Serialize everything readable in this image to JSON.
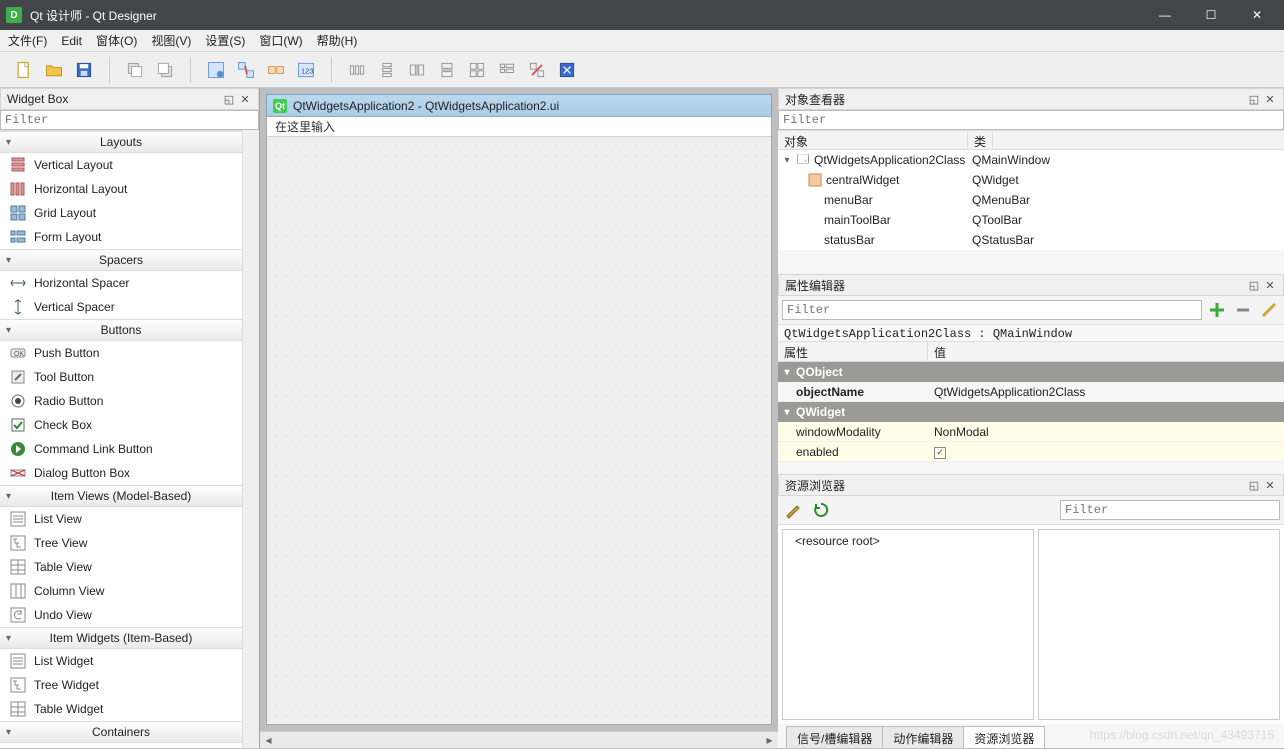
{
  "titlebar": {
    "title": "Qt 设计师 - Qt Designer"
  },
  "menu": {
    "file": "文件(F)",
    "edit": "Edit",
    "form": "窗体(O)",
    "view": "视图(V)",
    "settings": "设置(S)",
    "window": "窗口(W)",
    "help": "帮助(H)"
  },
  "left": {
    "title": "Widget Box",
    "filter_placeholder": "Filter",
    "categories": {
      "layouts": "Layouts",
      "spacers": "Spacers",
      "buttons": "Buttons",
      "item_views": "Item Views (Model-Based)",
      "item_widgets": "Item Widgets (Item-Based)",
      "containers": "Containers"
    },
    "items": {
      "vlayout": "Vertical Layout",
      "hlayout": "Horizontal Layout",
      "gridlayout": "Grid Layout",
      "formlayout": "Form Layout",
      "hspacer": "Horizontal Spacer",
      "vspacer": "Vertical Spacer",
      "pushbutton": "Push Button",
      "toolbutton": "Tool Button",
      "radiobutton": "Radio Button",
      "checkbox": "Check Box",
      "cmdlink": "Command Link Button",
      "dlgbtnbox": "Dialog Button Box",
      "listview": "List View",
      "treeview": "Tree View",
      "tableview": "Table View",
      "columnview": "Column View",
      "undoview": "Undo View",
      "listwidget": "List Widget",
      "treewidget": "Tree Widget",
      "tablewidget": "Table Widget"
    }
  },
  "center": {
    "mdi_title": "QtWidgetsApplication2 - QtWidgetsApplication2.ui",
    "type_here": "在这里输入"
  },
  "object_inspector": {
    "title": "对象查看器",
    "filter_placeholder": "Filter",
    "col_object": "对象",
    "col_class": "类",
    "rows": {
      "root_name": "QtWidgetsApplication2Class",
      "root_class": "QMainWindow",
      "central_name": "centralWidget",
      "central_class": "QWidget",
      "menubar_name": "menuBar",
      "menubar_class": "QMenuBar",
      "toolbar_name": "mainToolBar",
      "toolbar_class": "QToolBar",
      "status_name": "statusBar",
      "status_class": "QStatusBar"
    }
  },
  "property_editor": {
    "title": "属性编辑器",
    "filter_placeholder": "Filter",
    "path": "QtWidgetsApplication2Class : QMainWindow",
    "col_prop": "属性",
    "col_value": "值",
    "grp_qobject": "QObject",
    "objectName_label": "objectName",
    "objectName_value": "QtWidgetsApplication2Class",
    "grp_qwidget": "QWidget",
    "windowModality_label": "windowModality",
    "windowModality_value": "NonModal",
    "enabled_label": "enabled"
  },
  "resource_browser": {
    "title": "资源浏览器",
    "filter_placeholder": "Filter",
    "root": "<resource root>"
  },
  "bottom_tabs": {
    "signal_slot": "信号/槽编辑器",
    "action": "动作编辑器",
    "resource": "资源浏览器"
  },
  "watermark": "https://blog.csdn.net/qn_43493715"
}
